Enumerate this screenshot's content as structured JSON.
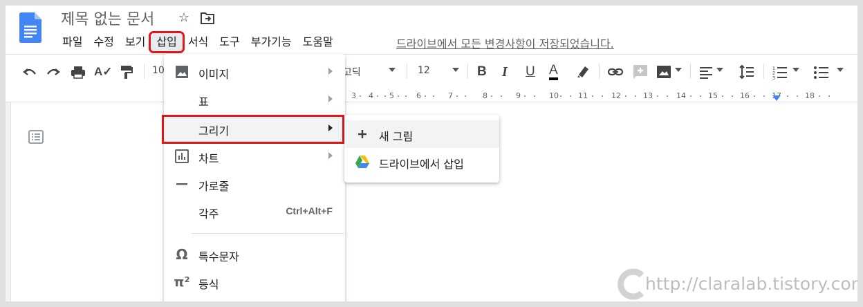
{
  "document": {
    "title": "제목 없는 문서"
  },
  "menubar": {
    "items": [
      "파일",
      "수정",
      "보기",
      "삽입",
      "서식",
      "도구",
      "부가기능",
      "도움말"
    ],
    "active": "삽입",
    "save_status": "드라이브에서 모든 변경사항이 저장되었습니다."
  },
  "toolbar": {
    "zoom_partial": "10",
    "font_name_partial": "고딕",
    "font_size": "12"
  },
  "ruler": {
    "numbers": [
      "3",
      "4",
      "5",
      "6",
      "7",
      "8",
      "9",
      "10",
      "11",
      "12",
      "13",
      "14",
      "15",
      "16",
      "17",
      "18"
    ]
  },
  "insert_menu": {
    "items": [
      {
        "label": "이미지",
        "icon": "image-icon",
        "has_submenu": true
      },
      {
        "label": "표",
        "icon": "",
        "has_submenu": true
      },
      {
        "label": "그리기",
        "icon": "",
        "has_submenu": true,
        "highlighted": true
      },
      {
        "label": "차트",
        "icon": "chart-icon",
        "has_submenu": true
      },
      {
        "label": "가로줄",
        "icon": "horizontal-line-icon",
        "has_submenu": false
      },
      {
        "label": "각주",
        "icon": "",
        "has_submenu": false,
        "shortcut": "Ctrl+Alt+F"
      },
      {
        "label": "특수문자",
        "icon": "omega-icon",
        "has_submenu": false
      },
      {
        "label": "등식",
        "icon": "pi-icon",
        "has_submenu": false
      }
    ]
  },
  "drawing_submenu": {
    "items": [
      {
        "label": "새 그림",
        "icon": "plus-icon"
      },
      {
        "label": "드라이브에서 삽입",
        "icon": "google-drive-icon"
      }
    ]
  },
  "watermark": {
    "text": "http://claralab.tistory.com"
  },
  "colors": {
    "highlight_red": "#e0161b",
    "docs_blue": "#4285f4",
    "menu_hover": "#f1f3f4"
  }
}
